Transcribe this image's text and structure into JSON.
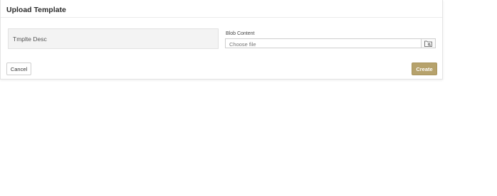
{
  "dialog": {
    "title": "Upload Template"
  },
  "form": {
    "description_value": "Tmplte Desc",
    "blob_label": "Blob Content",
    "file_placeholder": "Choose file",
    "browse_icon": "folder-search-icon"
  },
  "actions": {
    "cancel_label": "Cancel",
    "create_label": "Create"
  },
  "colors": {
    "primary_button": "#b6a26c",
    "panel_background": "#f3f3f3"
  }
}
